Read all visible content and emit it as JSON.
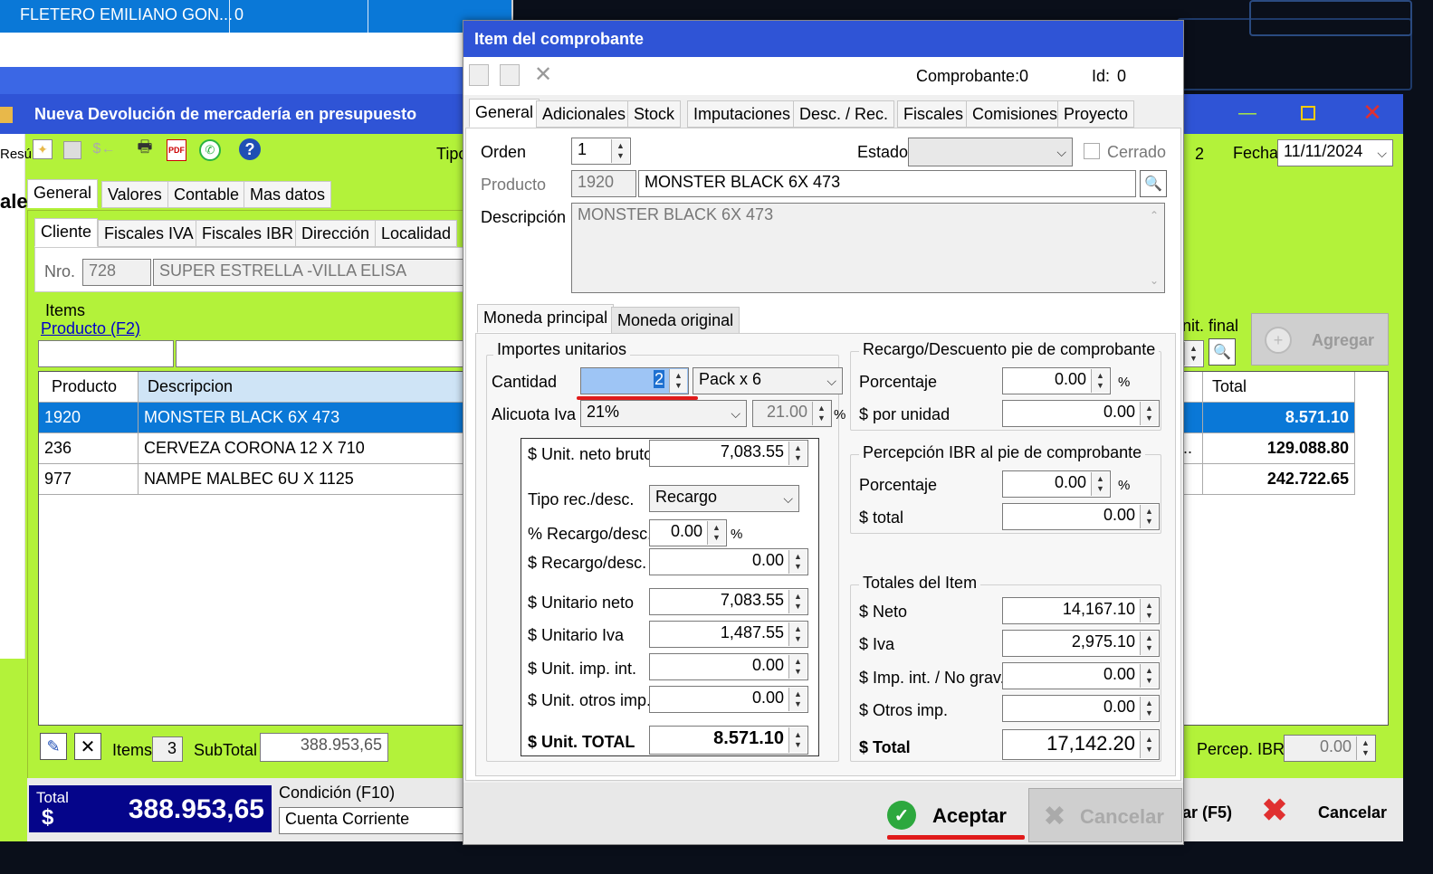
{
  "bg_window_top": {
    "col1": "FLETERO EMILIANO GON...",
    "col2": "0"
  },
  "main_window": {
    "title": "Nueva Devolución de mercadería en presupuesto",
    "left_fragment": "Resú",
    "left_label": "ale",
    "tipo_label": "Tipo",
    "numero": "2",
    "fecha_label": "Fecha",
    "fecha_value": "11/11/2024",
    "tabs": [
      "General",
      "Valores",
      "Contable",
      "Mas datos"
    ],
    "subtabs": [
      "Cliente",
      "Fiscales IVA",
      "Fiscales IBR",
      "Dirección",
      "Localidad"
    ],
    "nro_label": "Nro.",
    "nro_value": "728",
    "cliente_value": "SUPER ESTRELLA -VILLA ELISA",
    "items_label": "Items",
    "producto_link": "Producto (F2)",
    "unit_final_label": "nit. final",
    "agregar_label": "Agregar",
    "grid_headers": {
      "producto": "Producto",
      "descripcion": "Descripcion",
      "total": "Total"
    },
    "rows": [
      {
        "producto": "1920",
        "descripcion": "MONSTER BLACK 6X 473",
        "total": "8.571.10"
      },
      {
        "producto": "236",
        "descripcion": "CERVEZA CORONA 12 X 710",
        "total": "129.088.80"
      },
      {
        "producto": "977",
        "descripcion": "NAMPE MALBEC  6U X 1125",
        "total": "242.722.65"
      }
    ],
    "row_frag2": "..",
    "items_count_label": "Items",
    "items_count": "3",
    "subtotal_label": "SubTotal",
    "subtotal_value": "388.953,65",
    "percep_label": "Percep. IBR",
    "percep_value": "0.00",
    "total_label": "Total",
    "total_currency": "$",
    "total_value": "388.953,65",
    "condicion_label": "Condición (F10)",
    "condicion_value": "Cuenta Corriente",
    "f5_frag": "ar (F5)",
    "cancelar_label": "Cancelar"
  },
  "dialog": {
    "title": "Item del comprobante",
    "comprobante_label": "Comprobante:",
    "comprobante_value": "0",
    "id_label": "Id:",
    "id_value": "0",
    "tabs": [
      "General",
      "Adicionales",
      "Stock",
      "Imputaciones",
      "Desc. / Rec.",
      "Fiscales",
      "Comisiones",
      "Proyecto"
    ],
    "orden_label": "Orden",
    "orden_value": "1",
    "estado_label": "Estado",
    "estado_value": "",
    "cerrado_label": "Cerrado",
    "producto_label": "Producto",
    "producto_code": "1920",
    "producto_name": "MONSTER BLACK 6X 473",
    "descripcion_label": "Descripción",
    "descripcion_value": "MONSTER BLACK 6X 473",
    "moneda_tabs": [
      "Moneda principal",
      "Moneda original"
    ],
    "importes_label": "Importes unitarios",
    "cantidad_label": "Cantidad",
    "cantidad_value": "2",
    "pack_value": "Pack x 6",
    "alicuota_label": "Alicuota Iva",
    "alicuota_value": "21%",
    "alicuota_num": "21.00",
    "pct_sym": "%",
    "unit_neto_bruto_label": "$ Unit. neto bruto",
    "unit_neto_bruto": "7,083.55",
    "tipo_rec_label": "Tipo rec./desc.",
    "tipo_rec_value": "Recargo",
    "pct_rec_label": "% Recargo/desc.",
    "pct_rec_value": "0.00",
    "rec_label": "$ Recargo/desc.",
    "rec_value": "0.00",
    "unit_neto_label": "$ Unitario neto",
    "unit_neto": "7,083.55",
    "unit_iva_label": "$ Unitario Iva",
    "unit_iva": "1,487.55",
    "unit_imp_int_label": "$ Unit. imp. int.",
    "unit_imp_int": "0.00",
    "unit_otros_label": "$ Unit. otros imp.",
    "unit_otros": "0.00",
    "unit_total_label": "$ Unit. TOTAL",
    "unit_total": "8.571.10",
    "recargo_pie_label": "Recargo/Descuento pie de comprobante",
    "porcentaje_label": "Porcentaje",
    "porcentaje1": "0.00",
    "por_unidad_label": "$ por unidad",
    "por_unidad": "0.00",
    "percep_pie_label": "Percepción IBR al pie de comprobante",
    "porcentaje2": "0.00",
    "ptotal_label": "$ total",
    "ptotal": "0.00",
    "totales_label": "Totales del Item",
    "neto_label": "$ Neto",
    "neto": "14,167.10",
    "iva_label": "$ Iva",
    "iva": "2,975.10",
    "imp_int_label": "$ Imp. int. / No grav.",
    "imp_int": "0.00",
    "otros_label": "$ Otros imp.",
    "otros": "0.00",
    "total_label": "$ Total",
    "total": "17,142.20",
    "aceptar_label": "Aceptar",
    "cancelar_label": "Cancelar"
  },
  "colors": {
    "accent_green": "#b3f23a",
    "title_blue": "#2f54d6",
    "selection_blue": "#0a78d7",
    "total_navy": "#05058a",
    "annotation_red": "#e01b1b"
  }
}
